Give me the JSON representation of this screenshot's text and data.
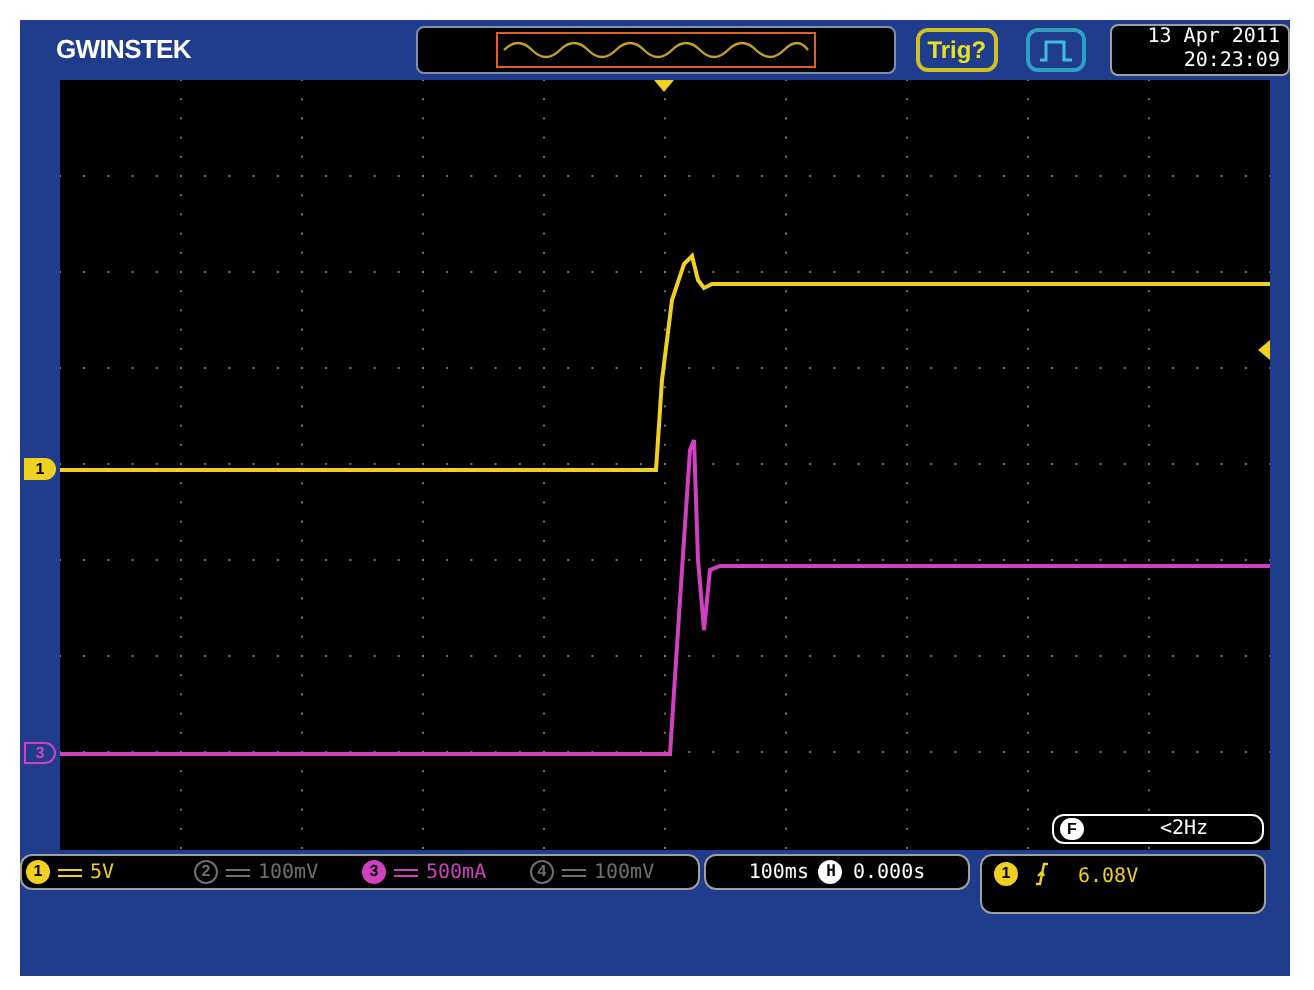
{
  "brand": "GWINSTEK",
  "header": {
    "trigger_status": "Trig?",
    "date": "13 Apr 2011",
    "time": "20:23:09"
  },
  "markers": [
    {
      "label": "1",
      "color": "#f0d020"
    },
    {
      "label": "3",
      "color": "#d040c0"
    }
  ],
  "frequency": {
    "label": "F",
    "value": "<2Hz"
  },
  "channels": [
    {
      "number": "1",
      "scale": "5V",
      "on": true,
      "color": "#f0d020"
    },
    {
      "number": "2",
      "scale": "100mV",
      "on": false
    },
    {
      "number": "3",
      "scale": "500mA",
      "on": true,
      "color": "#d040c0"
    },
    {
      "number": "4",
      "scale": "100mV",
      "on": false
    }
  ],
  "timebase": {
    "scale": "100ms",
    "label": "H",
    "position": "0.000s"
  },
  "trigger": {
    "source": "1",
    "level": "6.08V"
  }
}
